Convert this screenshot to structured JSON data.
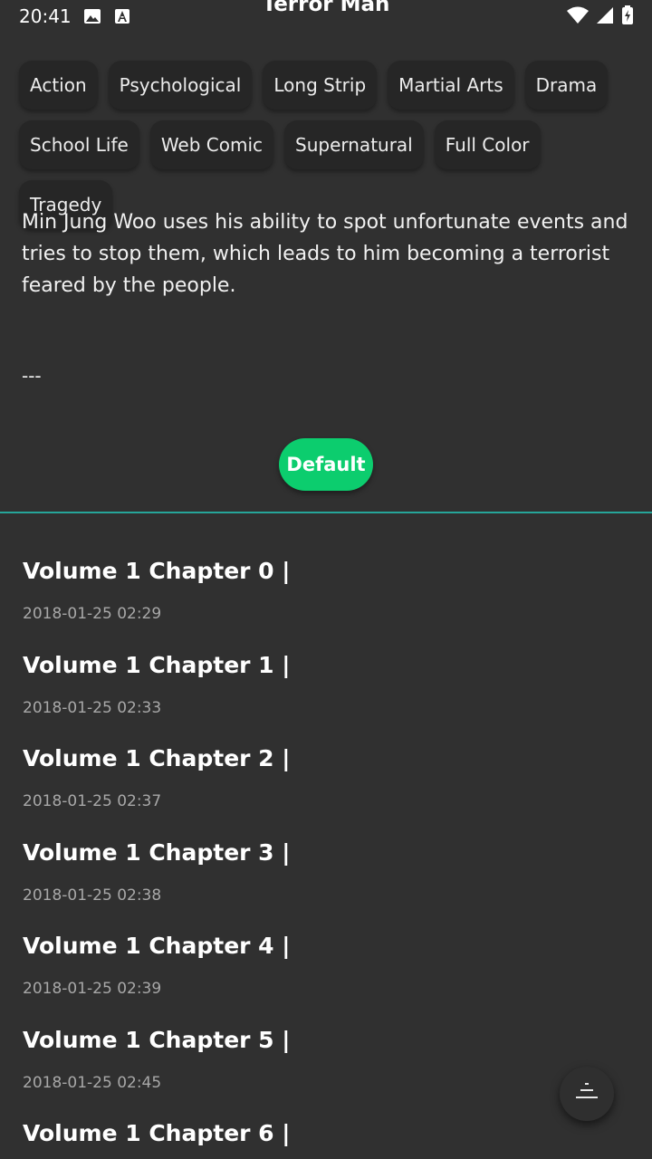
{
  "status_bar": {
    "time": "20:41",
    "left_icons": [
      "image-icon",
      "font-icon"
    ],
    "right_icons": [
      "wifi-icon",
      "signal-icon",
      "battery-charging-icon"
    ]
  },
  "header": {
    "title": "Terror Man"
  },
  "tags": [
    "Action",
    "Psychological",
    "Long Strip",
    "Martial Arts",
    "Drama",
    "School Life",
    "Web Comic",
    "Supernatural",
    "Full Color",
    "Tragedy"
  ],
  "description": "Min Jung Woo uses his ability to spot unfortunate events and tries to stop them, which leads to him becoming a terrorist feared by the people.",
  "separator": "---",
  "sort_button": {
    "label": "Default"
  },
  "colors": {
    "background": "#303030",
    "accent": "#0ccd6e",
    "divider": "#26a69a"
  },
  "chapters": [
    {
      "title": "Volume 1 Chapter 0 |",
      "date": "2018-01-25 02:29"
    },
    {
      "title": "Volume 1 Chapter 1 |",
      "date": "2018-01-25 02:33"
    },
    {
      "title": "Volume 1 Chapter 2 |",
      "date": "2018-01-25 02:37"
    },
    {
      "title": "Volume 1 Chapter 3 |",
      "date": "2018-01-25 02:38"
    },
    {
      "title": "Volume 1 Chapter 4 |",
      "date": "2018-01-25 02:39"
    },
    {
      "title": "Volume 1 Chapter 5 |",
      "date": "2018-01-25 02:45"
    },
    {
      "title": "Volume 1 Chapter 6 |",
      "date": ""
    }
  ],
  "fab": {
    "icon": "scroll-position-icon"
  }
}
